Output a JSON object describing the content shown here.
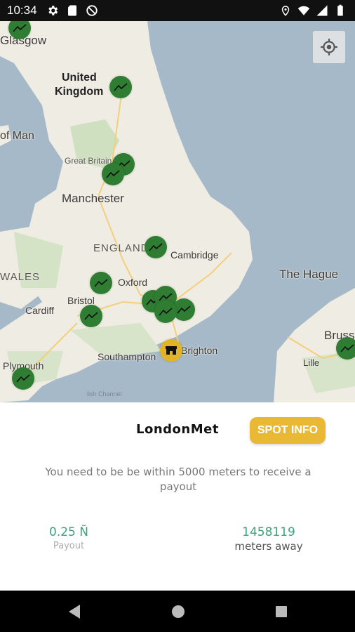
{
  "status_bar": {
    "time": "10:34",
    "left_icons": [
      "settings-icon",
      "sd-card-icon",
      "dnd-icon"
    ],
    "right_icons": [
      "location-icon",
      "wifi-icon",
      "signal-icon",
      "battery-icon"
    ]
  },
  "map": {
    "labels": {
      "glasgow": "Glasgow",
      "uk_line1": "United",
      "uk_line2": "Kingdom",
      "isle_of_man": "of Man",
      "great_britain": "Great Britain",
      "manchester": "Manchester",
      "england": "ENGLAND",
      "cambridge": "Cambridge",
      "wales": "WALES",
      "oxford": "Oxford",
      "bristol": "Bristol",
      "cardiff": "Cardiff",
      "southampton": "Southampton",
      "brighton": "Brighton",
      "plymouth": "Plymouth",
      "the_hague": "The Hague",
      "brussels": "Bruss",
      "lille": "Lille",
      "channel": "lish Channel"
    },
    "locate_button_icon": "my-location-icon",
    "colors": {
      "land": "#efece3",
      "sea": "#a6b9c8",
      "marker": "#2e7d32",
      "shop_marker": "#e0b426"
    }
  },
  "spot": {
    "name": "LondonMet",
    "info_button": "SPOT INFO",
    "hint": "You need to be be within 5000 meters to receive a payout",
    "payout_value": "0.25 Ñ",
    "payout_label": "Payout",
    "distance_value": "1458119",
    "distance_label": "meters away",
    "accent": "#e9b935",
    "value_color": "#3aa37a"
  },
  "nav_bar": {
    "icons": [
      "back-icon",
      "home-icon",
      "recents-icon"
    ]
  }
}
